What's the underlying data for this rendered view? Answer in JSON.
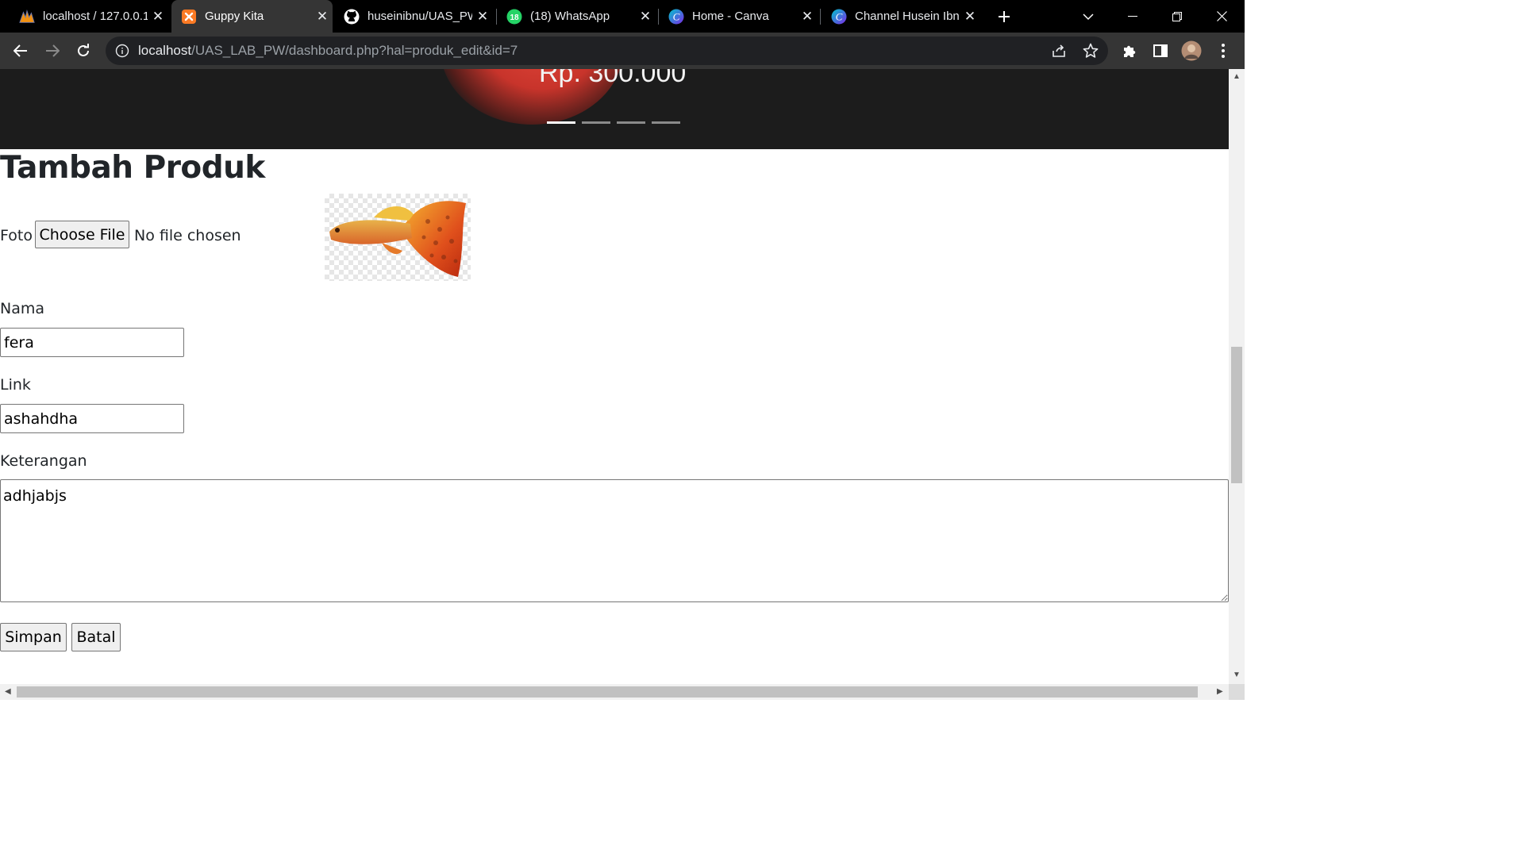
{
  "browser": {
    "tabs": [
      {
        "title": "localhost / 127.0.0.1",
        "icon": "phpmyadmin-icon",
        "active": false
      },
      {
        "title": "Guppy Kita",
        "icon": "xampp-icon",
        "active": true
      },
      {
        "title": "huseinibnu/UAS_PW",
        "icon": "github-icon",
        "active": false
      },
      {
        "title": "(18) WhatsApp",
        "icon": "whatsapp-icon",
        "active": false,
        "badge": "18"
      },
      {
        "title": "Home - Canva",
        "icon": "canva-icon",
        "active": false
      },
      {
        "title": "Channel Husein Ibnu",
        "icon": "canva-icon",
        "active": false
      }
    ],
    "url_host": "localhost",
    "url_path": "/UAS_LAB_PW/dashboard.php?hal=produk_edit&id=7",
    "favicon_letters": {
      "xampp": "ꙮ",
      "canva": "C"
    }
  },
  "hero": {
    "price": "Rp. 300.000",
    "slides": 4,
    "active_slide": 1
  },
  "form": {
    "title": "Tambah Produk",
    "foto_label": "Foto",
    "file_button": "Choose File",
    "file_status": "No file chosen",
    "nama_label": "Nama",
    "nama_value": "fera",
    "link_label": "Link",
    "link_value": "ashahdha",
    "keterangan_label": "Keterangan",
    "keterangan_value": "adhjabjs",
    "save_button": "Simpan",
    "cancel_button": "Batal"
  },
  "colors": {
    "chrome_dark": "#000000",
    "toolbar": "#353535",
    "hero_bg": "#1c1c1c",
    "whatsapp": "#25d366",
    "canva": "#00c4cc",
    "xampp": "#fb7a24"
  }
}
